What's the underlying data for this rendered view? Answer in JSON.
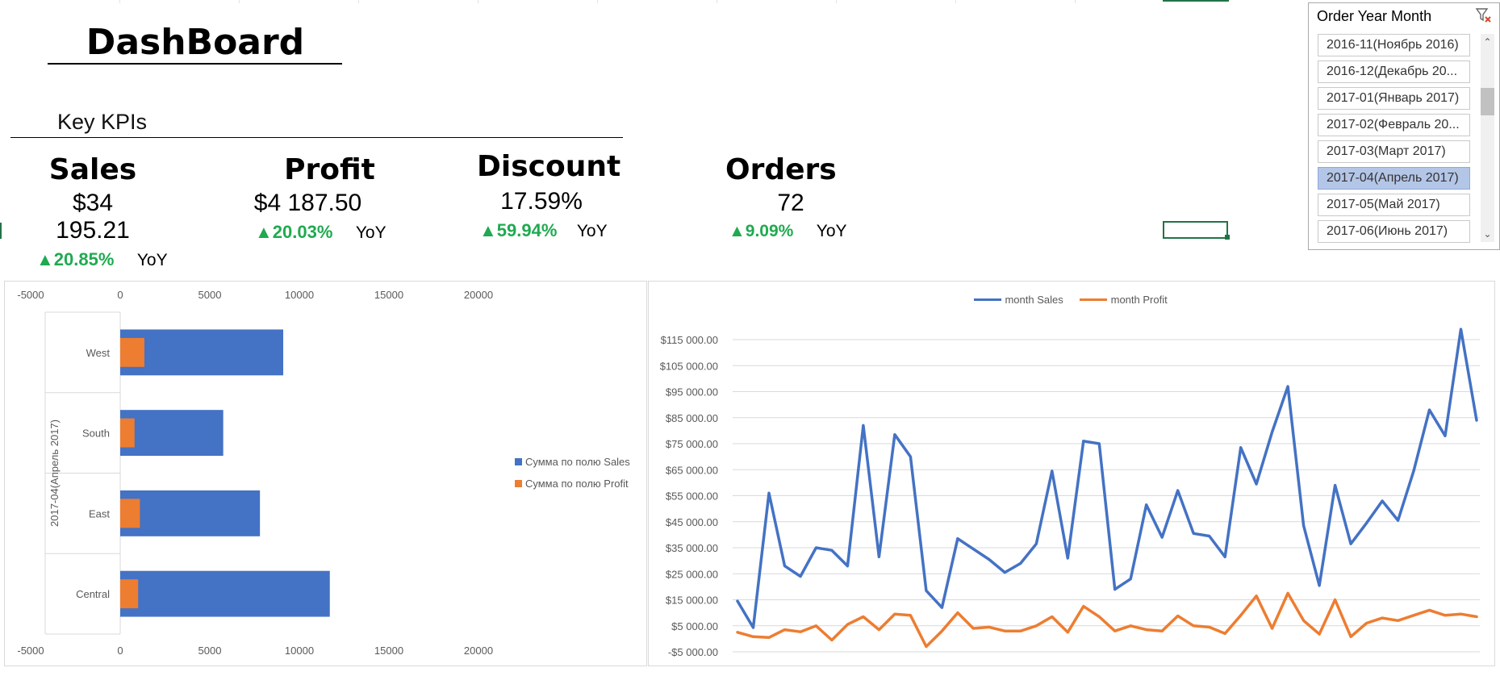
{
  "dashboard": {
    "title": "DashBoard",
    "kpi_heading": "Key KPIs"
  },
  "kpis": [
    {
      "label": "Sales",
      "value": "$34 195.21",
      "change": "▲20.85%",
      "yoy": "YoY"
    },
    {
      "label": "Profit",
      "value": "$4 187.50",
      "change": "▲20.03%",
      "yoy": "YoY"
    },
    {
      "label": "Discount",
      "value": "17.59%",
      "change": "▲59.94%",
      "yoy": "YoY"
    },
    {
      "label": "Orders",
      "value": "72",
      "change": "▲9.09%",
      "yoy": "YoY"
    }
  ],
  "slicer": {
    "title": "Order Year Month",
    "items": [
      "2016-11(Ноябрь 2016)",
      "2016-12(Декабрь 20...",
      "2017-01(Январь 2017)",
      "2017-02(Февраль 20...",
      "2017-03(Март 2017)",
      "2017-04(Апрель 2017)",
      "2017-05(Май 2017)",
      "2017-06(Июнь 2017)"
    ],
    "selected_index": 5,
    "icons": {
      "filter": "clear-filter-icon",
      "up": "scroll-up-icon",
      "down": "scroll-down-icon"
    }
  },
  "colors": {
    "blue": "#4472c4",
    "orange": "#ed7d31",
    "green": "#1faa50",
    "selection": "#b4c6e7"
  },
  "chart_data": [
    {
      "type": "bar",
      "orientation": "horizontal",
      "axis_group_label": "2017-04(Апрель 2017)",
      "categories": [
        "West",
        "South",
        "East",
        "Central"
      ],
      "series": [
        {
          "name": "Сумма по полю Sales",
          "values": [
            9100,
            5750,
            7800,
            11700
          ]
        },
        {
          "name": "Сумма по полю Profit",
          "values": [
            1350,
            800,
            1100,
            1000
          ]
        }
      ],
      "xlim": [
        -5000,
        20000
      ],
      "xticks": [
        "-5000",
        "0",
        "5000",
        "10000",
        "15000",
        "20000"
      ],
      "legend_position": "right"
    },
    {
      "type": "line",
      "series": [
        {
          "name": "month Sales",
          "values": [
            14500,
            4300,
            56000,
            28000,
            24000,
            35000,
            34000,
            28000,
            82000,
            31500,
            78500,
            70000,
            18500,
            12000,
            38500,
            34500,
            30500,
            25500,
            29000,
            36500,
            64500,
            31000,
            76000,
            75000,
            19000,
            23000,
            51500,
            39000,
            57000,
            40500,
            39500,
            31500,
            73500,
            59500,
            79500,
            97000,
            43500,
            20500,
            59000,
            36500,
            44500,
            53000,
            45500,
            64500,
            88000,
            78000,
            119000,
            84000
          ]
        },
        {
          "name": "month Profit",
          "values": [
            2500,
            800,
            500,
            3500,
            2700,
            5000,
            -500,
            5500,
            8500,
            3500,
            9500,
            9000,
            -3000,
            3000,
            10000,
            4000,
            4500,
            3000,
            3000,
            5000,
            8500,
            2500,
            12500,
            8500,
            3000,
            5000,
            3500,
            3000,
            8800,
            5000,
            4500,
            2000,
            9000,
            16500,
            4000,
            17500,
            7000,
            1800,
            15000,
            800,
            6000,
            8000,
            7000,
            9000,
            11000,
            9000,
            9500,
            8500
          ]
        }
      ],
      "yticks": [
        "$115 000.00",
        "$105 000.00",
        "$95 000.00",
        "$85 000.00",
        "$75 000.00",
        "$65 000.00",
        "$55 000.00",
        "$45 000.00",
        "$35 000.00",
        "$25 000.00",
        "$15 000.00",
        "$5 000.00",
        "-$5 000.00"
      ],
      "ylim": [
        -5000,
        115000
      ],
      "grid": true,
      "legend_position": "top"
    }
  ]
}
